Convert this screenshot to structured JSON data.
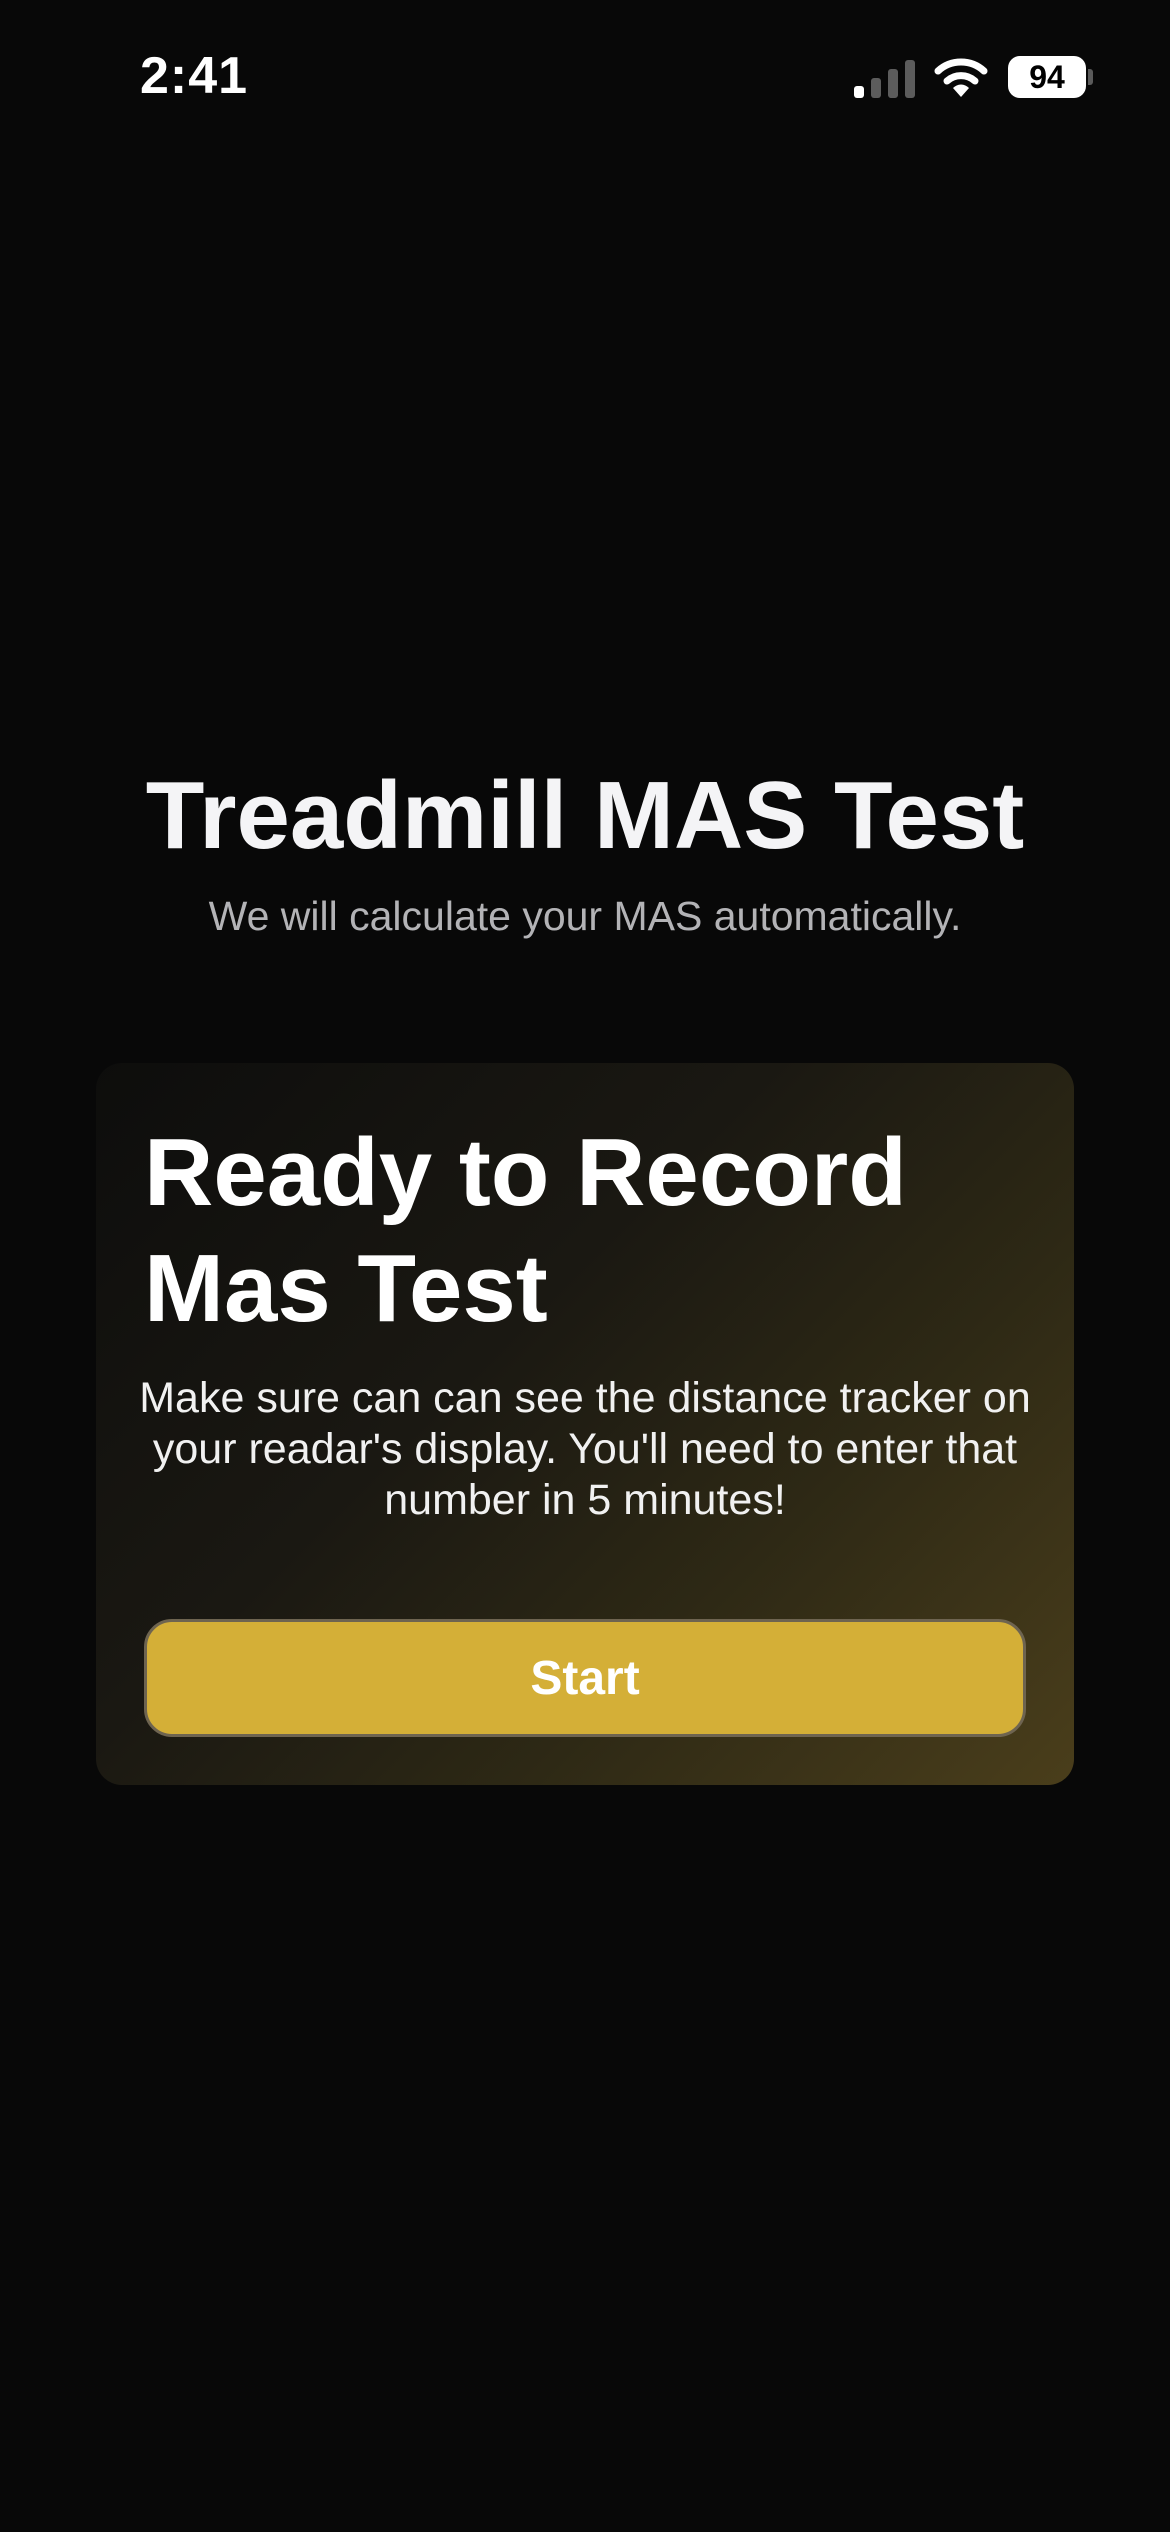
{
  "status_bar": {
    "time": "2:41",
    "battery_level": "94",
    "signal_icon": "cell-signal-icon",
    "wifi_icon": "wifi-icon",
    "battery_icon": "battery-icon"
  },
  "header": {
    "title": "Treadmill MAS Test",
    "subtitle": "We will calculate your MAS automatically."
  },
  "card": {
    "title": "Ready to Record Mas Test",
    "body": "Make sure can can see the distance tracker on your readar's display. You'll need to enter that number in 5 minutes!",
    "start_label": "Start"
  },
  "colors": {
    "background": "#080808",
    "accent": "#d4af37",
    "card_gradient_end": "#4a3e1b",
    "subtitle": "#b3b3b6"
  }
}
